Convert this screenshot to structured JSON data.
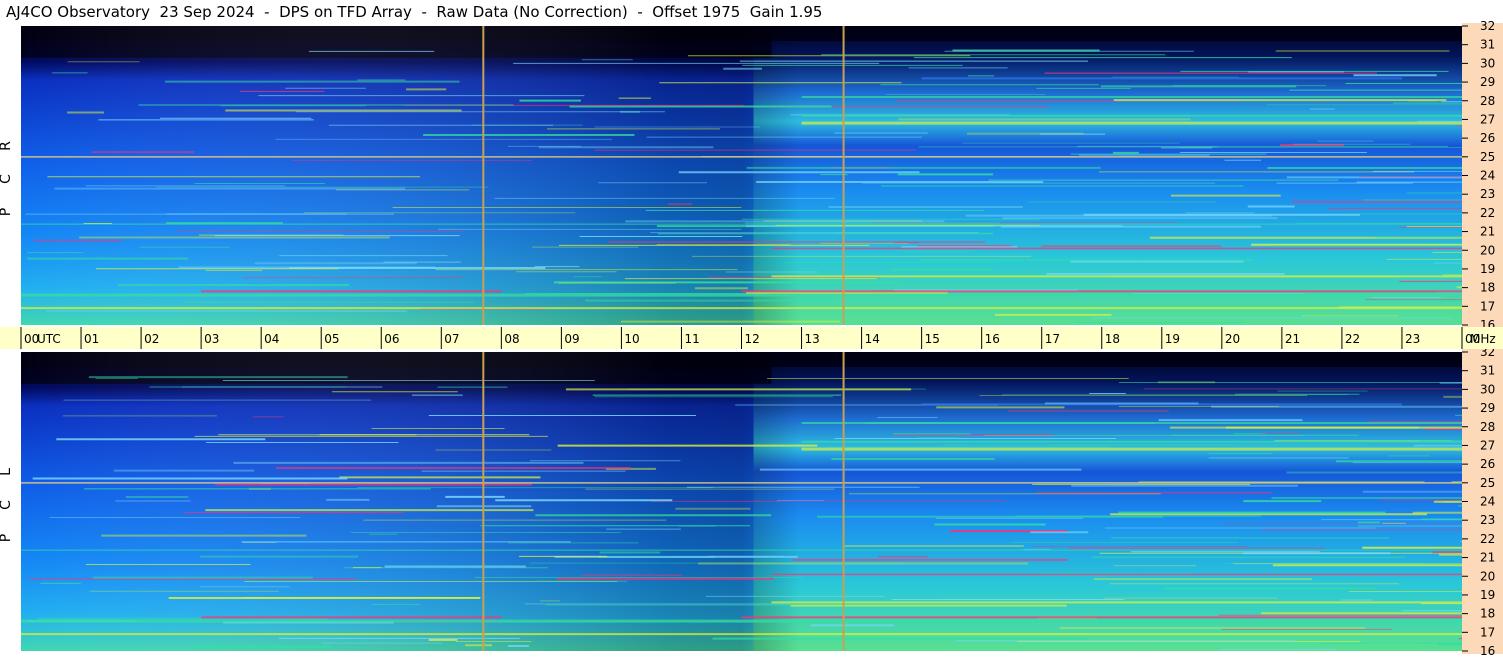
{
  "title": "AJ4CO Observatory  23 Sep 2024  -  DPS on TFD Array  -  Raw Data (No Correction)  -  Offset 1975  Gain 1.95",
  "colors": {
    "background": "#ffffff",
    "axis_band": "#ffffc8",
    "freq_band": "#fcd9b8",
    "marker_line": "#c8a050",
    "sky_low": "#000018",
    "sky_mid": "#0a3ed8",
    "sky_high": "#19a9ff",
    "band_green": "#34e0a0",
    "band_yellow": "#d8f040",
    "band_hot": "#ff3078"
  },
  "chart_data": {
    "type": "heatmap",
    "title": "AJ4CO Observatory  23 Sep 2024  -  DPS on TFD Array  -  Raw Data (No Correction)  -  Offset 1975  Gain 1.95",
    "x_axis": {
      "unit": "UTC",
      "range": [
        0,
        24
      ],
      "tick_labels": [
        "00",
        "01",
        "02",
        "03",
        "04",
        "05",
        "06",
        "07",
        "08",
        "09",
        "10",
        "11",
        "12",
        "13",
        "14",
        "15",
        "16",
        "17",
        "18",
        "19",
        "20",
        "21",
        "22",
        "23",
        "00"
      ]
    },
    "y_axis": {
      "unit": "MHz",
      "range": [
        16,
        32
      ],
      "tick_labels": [
        "16",
        "17",
        "18",
        "19",
        "20",
        "21",
        "22",
        "23",
        "24",
        "25",
        "26",
        "27",
        "28",
        "29",
        "30",
        "31",
        "32"
      ]
    },
    "panels": [
      {
        "label_letters": [
          "R",
          "C",
          "P"
        ]
      },
      {
        "label_letters": [
          "L",
          "C",
          "P"
        ]
      }
    ],
    "vertical_markers_utc": [
      7.7,
      13.7
    ],
    "persistent_carriers_mhz": [
      25.0,
      27.2,
      17.8,
      20.0,
      26.8
    ]
  }
}
